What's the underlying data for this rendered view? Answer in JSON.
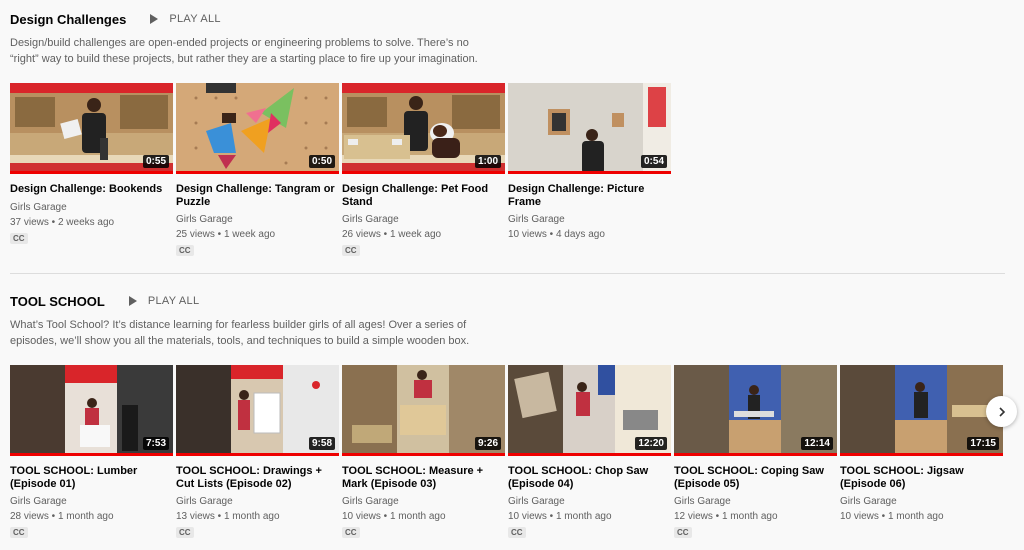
{
  "sections": [
    {
      "title": "Design Challenges",
      "play_all": "PLAY ALL",
      "description": "Design/build challenges are open-ended projects or engineering problems to solve. There’s no “right” way to build these projects, but rather they are a starting place to fire up your imagination.",
      "videos": [
        {
          "title": "Design Challenge: Bookends",
          "channel": "Girls Garage",
          "meta": "37 views • 2 weeks ago",
          "duration": "0:55",
          "cc": "CC"
        },
        {
          "title": "Design Challenge: Tangram or Puzzle",
          "channel": "Girls Garage",
          "meta": "25 views • 1 week ago",
          "duration": "0:50",
          "cc": "CC"
        },
        {
          "title": "Design Challenge: Pet Food Stand",
          "channel": "Girls Garage",
          "meta": "26 views • 1 week ago",
          "duration": "1:00",
          "cc": "CC"
        },
        {
          "title": "Design Challenge: Picture Frame",
          "channel": "Girls Garage",
          "meta": "10 views • 4 days ago",
          "duration": "0:54",
          "cc": ""
        }
      ]
    },
    {
      "title": "TOOL SCHOOL",
      "play_all": "PLAY ALL",
      "description": "What’s Tool School? It’s distance learning for fearless builder girls of all ages! Over a series of episodes, we’ll show you all the materials, tools, and techniques to build a simple wooden box.",
      "videos": [
        {
          "title": "TOOL SCHOOL: Lumber (Episode 01)",
          "channel": "Girls Garage",
          "meta": "28 views • 1 month ago",
          "duration": "7:53",
          "cc": "CC"
        },
        {
          "title": "TOOL SCHOOL: Drawings + Cut Lists (Episode 02)",
          "channel": "Girls Garage",
          "meta": "13 views • 1 month ago",
          "duration": "9:58",
          "cc": "CC"
        },
        {
          "title": "TOOL SCHOOL: Measure + Mark (Episode 03)",
          "channel": "Girls Garage",
          "meta": "10 views • 1 month ago",
          "duration": "9:26",
          "cc": "CC"
        },
        {
          "title": "TOOL SCHOOL: Chop Saw (Episode 04)",
          "channel": "Girls Garage",
          "meta": "10 views • 1 month ago",
          "duration": "12:20",
          "cc": "CC"
        },
        {
          "title": "TOOL SCHOOL: Coping Saw (Episode 05)",
          "channel": "Girls Garage",
          "meta": "12 views • 1 month ago",
          "duration": "12:14",
          "cc": "CC"
        },
        {
          "title": "TOOL SCHOOL: Jigsaw (Episode 06)",
          "channel": "Girls Garage",
          "meta": "10 views • 1 month ago",
          "duration": "17:15",
          "cc": ""
        }
      ]
    }
  ],
  "icons": {
    "play_all": "play-icon",
    "next": "chevron-right-icon"
  },
  "colors": {
    "progress": "#ee0000",
    "accent_red": "#d9252a"
  }
}
